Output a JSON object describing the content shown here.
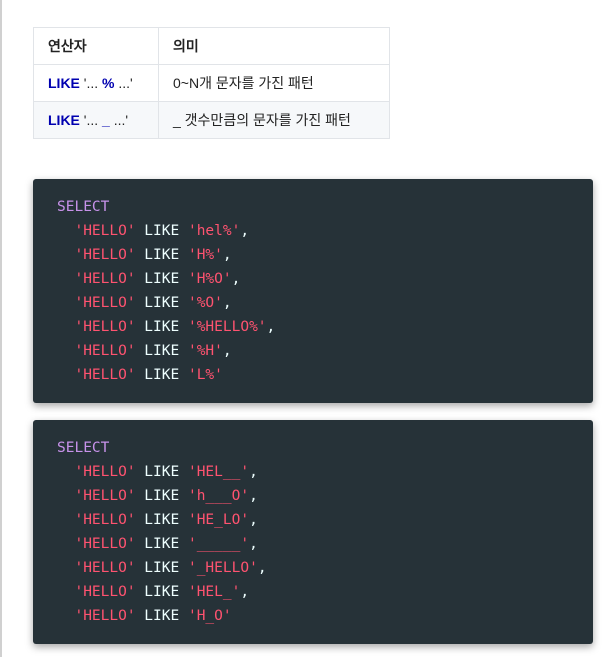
{
  "table": {
    "headers": [
      "연산자",
      "의미"
    ],
    "rows": [
      {
        "kw": "LIKE",
        "pattern_pre": " '... ",
        "pattern_mark": "%",
        "pattern_post": " ...'",
        "meaning": "0~N개 문자를 가진 패턴"
      },
      {
        "kw": "LIKE",
        "pattern_pre": " '... ",
        "pattern_mark": "_",
        "pattern_post": " ...'",
        "meaning": "_ 갯수만큼의 문자를 가진 패턴"
      }
    ]
  },
  "code1": {
    "keyword": "SELECT",
    "lines": [
      {
        "left": "'HELLO'",
        "op": " LIKE ",
        "right": "'hel%'",
        "sep": ","
      },
      {
        "left": "'HELLO'",
        "op": " LIKE ",
        "right": "'H%'",
        "sep": ","
      },
      {
        "left": "'HELLO'",
        "op": " LIKE ",
        "right": "'H%O'",
        "sep": ","
      },
      {
        "left": "'HELLO'",
        "op": " LIKE ",
        "right": "'%O'",
        "sep": ","
      },
      {
        "left": "'HELLO'",
        "op": " LIKE ",
        "right": "'%HELLO%'",
        "sep": ","
      },
      {
        "left": "'HELLO'",
        "op": " LIKE ",
        "right": "'%H'",
        "sep": ","
      },
      {
        "left": "'HELLO'",
        "op": " LIKE ",
        "right": "'L%'",
        "sep": ""
      }
    ]
  },
  "code2": {
    "keyword": "SELECT",
    "lines": [
      {
        "left": "'HELLO'",
        "op": " LIKE ",
        "right": "'HEL__'",
        "sep": ","
      },
      {
        "left": "'HELLO'",
        "op": " LIKE ",
        "right": "'h___O'",
        "sep": ","
      },
      {
        "left": "'HELLO'",
        "op": " LIKE ",
        "right": "'HE_LO'",
        "sep": ","
      },
      {
        "left": "'HELLO'",
        "op": " LIKE ",
        "right": "'_____'",
        "sep": ","
      },
      {
        "left": "'HELLO'",
        "op": " LIKE ",
        "right": "'_HELLO'",
        "sep": ","
      },
      {
        "left": "'HELLO'",
        "op": " LIKE ",
        "right": "'HEL_'",
        "sep": ","
      },
      {
        "left": "'HELLO'",
        "op": " LIKE ",
        "right": "'H_O'",
        "sep": ""
      }
    ]
  }
}
